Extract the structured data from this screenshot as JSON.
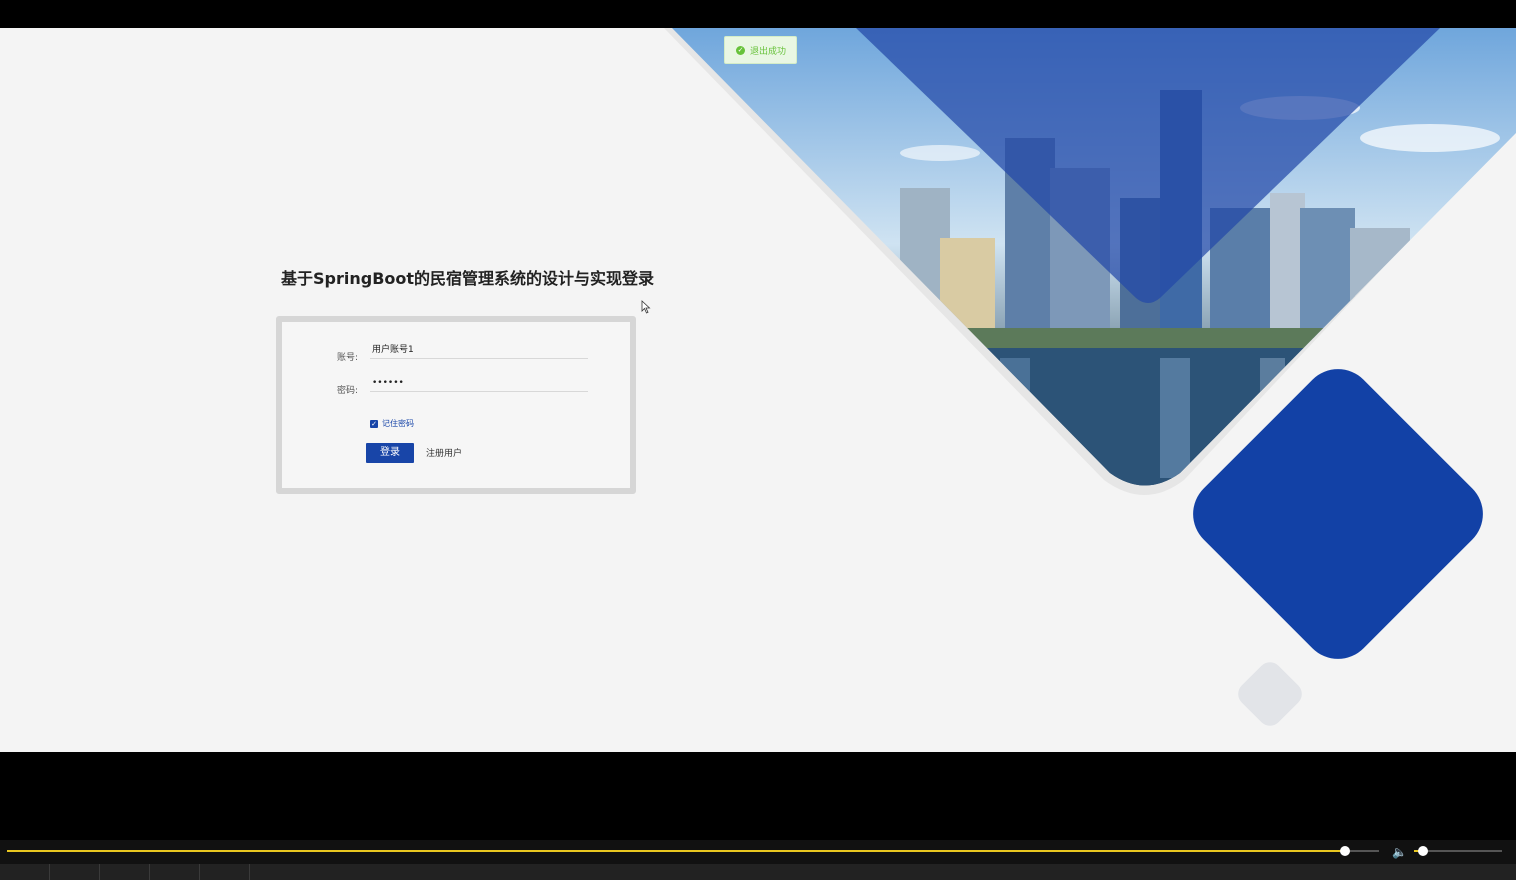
{
  "toast": {
    "icon": "check-circle-icon",
    "text": "退出成功"
  },
  "login": {
    "title": "基于SpringBoot的民宿管理系统的设计与实现登录",
    "account_label": "账号:",
    "account_value": "用户账号1",
    "password_label": "密码:",
    "password_value": "••••••",
    "remember_label": "记住密码",
    "remember_checked": true,
    "login_button": "登录",
    "register_link": "注册用户"
  },
  "player": {
    "progress": 0.975,
    "volume": 0.1,
    "volume_icon": "speaker-icon"
  },
  "colors": {
    "accent": "#1845a8",
    "success": "#67c23a",
    "progress": "#e8c620"
  }
}
